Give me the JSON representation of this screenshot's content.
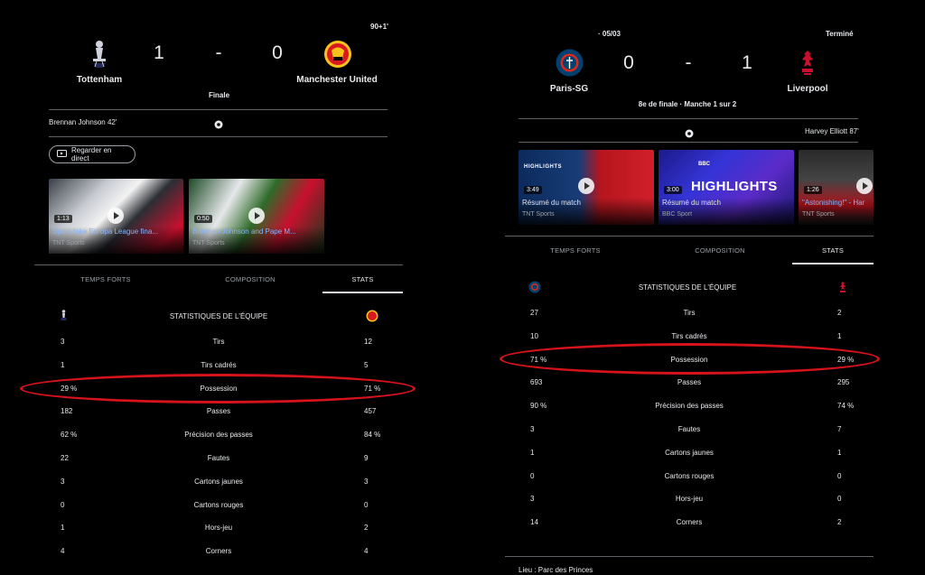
{
  "left": {
    "time": "90+1'",
    "home": {
      "name": "Tottenham",
      "score": "1"
    },
    "away": {
      "name": "Manchester United",
      "score": "0"
    },
    "dash": "-",
    "status": "Finale",
    "scorer": "Brennan Johnson 42'",
    "live_button": "Regarder en direct",
    "videos": [
      {
        "duration": "1:13",
        "title": "Spurs take Europa League fina...",
        "source": "TNT Sports"
      },
      {
        "duration": "0:50",
        "title": "Brennan Johnson and Pape M...",
        "source": "TNT Sports"
      }
    ],
    "tabs": [
      "TEMPS FORTS",
      "COMPOSITION",
      "STATS"
    ],
    "stats_title": "STATISTIQUES DE L'ÉQUIPE",
    "stats": [
      {
        "home": "3",
        "label": "Tirs",
        "away": "12"
      },
      {
        "home": "1",
        "label": "Tirs cadrés",
        "away": "5"
      },
      {
        "home": "29 %",
        "label": "Possession",
        "away": "71 %"
      },
      {
        "home": "182",
        "label": "Passes",
        "away": "457"
      },
      {
        "home": "62 %",
        "label": "Précision des passes",
        "away": "84 %"
      },
      {
        "home": "22",
        "label": "Fautes",
        "away": "9"
      },
      {
        "home": "3",
        "label": "Cartons jaunes",
        "away": "3"
      },
      {
        "home": "0",
        "label": "Cartons rouges",
        "away": "0"
      },
      {
        "home": "1",
        "label": "Hors-jeu",
        "away": "2"
      },
      {
        "home": "4",
        "label": "Corners",
        "away": "4"
      }
    ]
  },
  "right": {
    "date": "· 05/03",
    "state": "Terminé",
    "home": {
      "name": "Paris-SG",
      "score": "0"
    },
    "away": {
      "name": "Liverpool",
      "score": "1"
    },
    "dash": "-",
    "round": "8e de finale · Manche 1 sur 2",
    "scorer": "Harvey Elliott 87'",
    "videos": [
      {
        "duration": "3:49",
        "title": "Résumé du match",
        "source": "TNT Sports",
        "overlay": "HIGHLIGHTS"
      },
      {
        "duration": "3:00",
        "title": "Résumé du match",
        "source": "BBC Sport",
        "overlay": "HIGHLIGHTS"
      },
      {
        "duration": "1:26",
        "title": "\"Astonishing!\" - Har",
        "source": "TNT Sports"
      }
    ],
    "tabs": [
      "TEMPS FORTS",
      "COMPOSITION",
      "STATS"
    ],
    "stats_title": "STATISTIQUES DE L'ÉQUIPE",
    "stats": [
      {
        "home": "27",
        "label": "Tirs",
        "away": "2"
      },
      {
        "home": "10",
        "label": "Tirs cadrés",
        "away": "1"
      },
      {
        "home": "71 %",
        "label": "Possession",
        "away": "29 %"
      },
      {
        "home": "693",
        "label": "Passes",
        "away": "295"
      },
      {
        "home": "90 %",
        "label": "Précision des passes",
        "away": "74 %"
      },
      {
        "home": "3",
        "label": "Fautes",
        "away": "7"
      },
      {
        "home": "1",
        "label": "Cartons jaunes",
        "away": "1"
      },
      {
        "home": "0",
        "label": "Cartons rouges",
        "away": "0"
      },
      {
        "home": "3",
        "label": "Hors-jeu",
        "away": "0"
      },
      {
        "home": "14",
        "label": "Corners",
        "away": "2"
      }
    ],
    "venue": "Lieu : Parc des Princes"
  },
  "colors": {
    "highlight_oval": "#d6121b",
    "link": "#8ab4f8",
    "divider": "#5f6368"
  }
}
